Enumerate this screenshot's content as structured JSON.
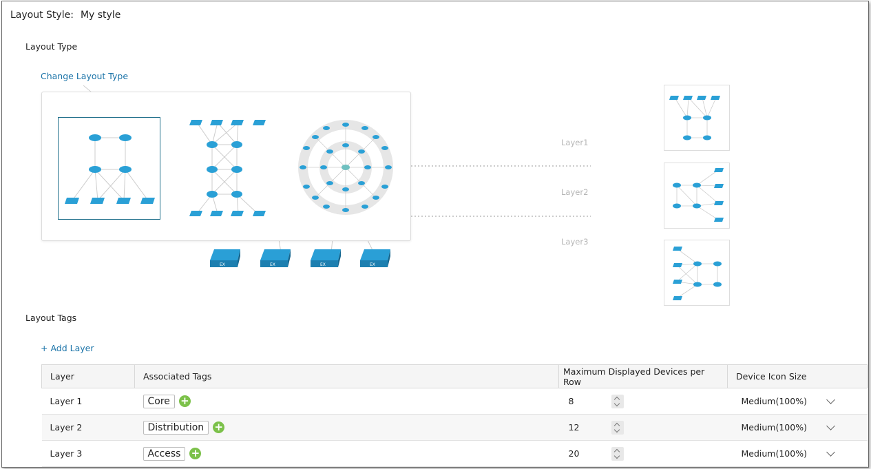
{
  "layout_style": {
    "label": "Layout Style:",
    "value": "My style"
  },
  "layout_type": {
    "title": "Layout Type",
    "change_link": "Change Layout Type"
  },
  "diagram": {
    "layers": [
      "Layer1",
      "Layer2",
      "Layer3"
    ]
  },
  "layout_tags": {
    "title": "Layout Tags",
    "add_layer": "+ Add Layer"
  },
  "table": {
    "headers": [
      "Layer",
      "Associated Tags",
      "Maximum Displayed Devices per Row",
      "Device Icon Size"
    ],
    "rows": [
      {
        "layer": "Layer 1",
        "tag": "Core",
        "max": "8",
        "size": "Medium(100%)"
      },
      {
        "layer": "Layer 2",
        "tag": "Distribution",
        "max": "12",
        "size": "Medium(100%)"
      },
      {
        "layer": "Layer 3",
        "tag": "Access",
        "max": "20",
        "size": "Medium(100%)"
      }
    ]
  },
  "colors": {
    "link": "#1a73a8",
    "add": "#7cc14a",
    "device": "#2aa0d6"
  }
}
